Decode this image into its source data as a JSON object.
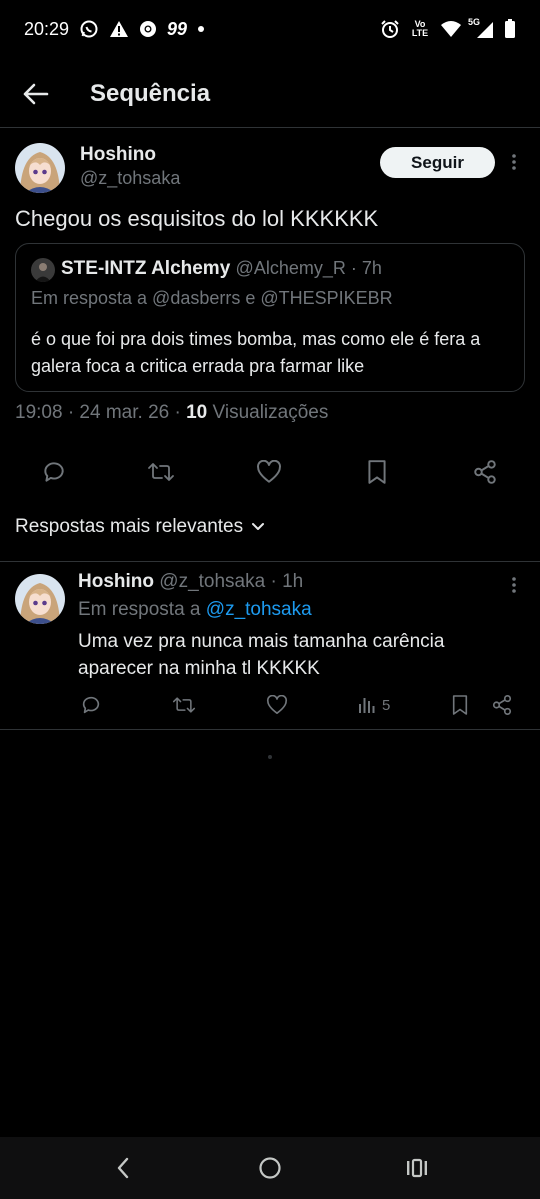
{
  "status_bar": {
    "time": "20:29",
    "left_icons": [
      "whatsapp-icon",
      "warning-icon",
      "chrome-icon",
      "quote-app-icon",
      "dot-icon"
    ],
    "right_icons": [
      "alarm-icon",
      "volte-icon",
      "wifi-icon",
      "signal-5g-icon",
      "battery-icon"
    ],
    "volte_label": "Vo LTE",
    "network_label": "5G",
    "app_badge": "99"
  },
  "header": {
    "title": "Sequência"
  },
  "tweet": {
    "author_name": "Hoshino",
    "author_handle": "@z_tohsaka",
    "follow_label": "Seguir",
    "text": "Chegou os esquisitos do lol KKKKKK",
    "timestamp": "19:08 · 24 mar. 26 · ",
    "views_count": "10",
    "views_label": " Visualizações"
  },
  "quote": {
    "author_name": "STE-INTZ Alchemy",
    "author_handle": "@Alchemy_R",
    "time": " · 7h",
    "reply_to": "Em resposta a @dasberrs e @THESPIKEBR",
    "body": "é o que foi pra dois times bomba, mas como ele é fera a galera foca a critica errada pra farmar like"
  },
  "sort": {
    "label": "Respostas mais relevantes"
  },
  "reply": {
    "author_name": "Hoshino",
    "author_handle": "@z_tohsaka",
    "time": "1h",
    "separator": " · ",
    "reply_prefix": "Em resposta a ",
    "reply_mention": "@z_tohsaka",
    "body": "Uma vez pra nunca mais tamanha carência aparecer na minha tl KKKKK",
    "views": "5"
  },
  "colors": {
    "background": "#000000",
    "text": "#e7e9ea",
    "muted": "#71767b",
    "divider": "#2f3336",
    "accent": "#1d9bf0",
    "follow_bg": "#eff3f4"
  }
}
